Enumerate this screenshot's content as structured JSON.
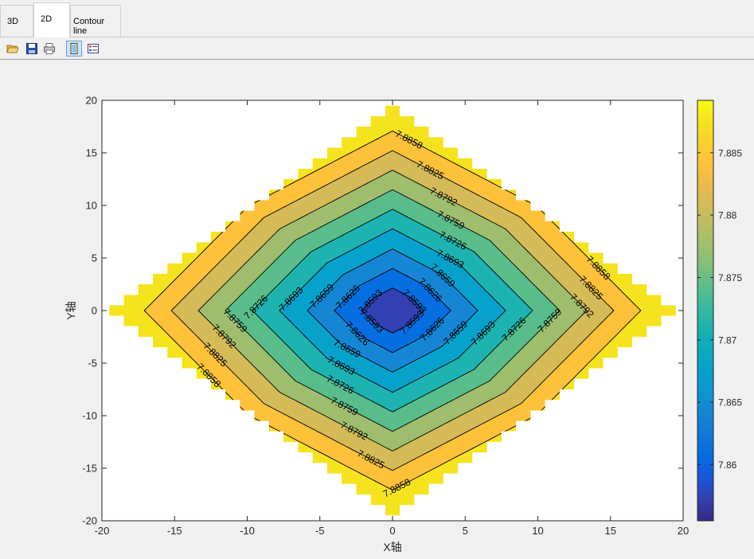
{
  "tabs": [
    {
      "label": "3D",
      "active": false
    },
    {
      "label": "2D",
      "active": true
    },
    {
      "label": "Contour line",
      "active": false
    }
  ],
  "toolbar": {
    "icons": [
      "open-folder-icon",
      "save-icon",
      "print-icon",
      "toggle-view-icon",
      "legend-icon"
    ]
  },
  "chart_data": {
    "type": "contour",
    "title": "",
    "xlabel": "X轴",
    "ylabel": "Y轴",
    "xlim": [
      -20,
      20
    ],
    "ylim": [
      -20,
      20
    ],
    "xticks": [
      -20,
      -15,
      -10,
      -5,
      0,
      5,
      10,
      15,
      20
    ],
    "yticks": [
      -20,
      -15,
      -10,
      -5,
      0,
      5,
      10,
      15,
      20
    ],
    "domain": "diamond |x|+|y| <= 19",
    "center_value": 7.8555,
    "edge_value": 7.8892,
    "levels": [
      7.8593,
      7.8626,
      7.8659,
      7.8693,
      7.8726,
      7.8759,
      7.8792,
      7.8825,
      7.8858
    ],
    "level_labels": [
      "7.8593",
      "7.8626",
      "7.8659",
      "7.8693",
      "7.8726",
      "7.8759",
      "7.8792",
      "7.8825",
      "7.8858"
    ],
    "colorbar": {
      "range": [
        7.8555,
        7.8892
      ],
      "ticks": [
        7.86,
        7.865,
        7.87,
        7.875,
        7.88,
        7.885
      ],
      "tick_labels": [
        "7.86",
        "7.865",
        "7.87",
        "7.875",
        "7.88",
        "7.885"
      ],
      "colormap": "parula"
    },
    "grid": false
  }
}
